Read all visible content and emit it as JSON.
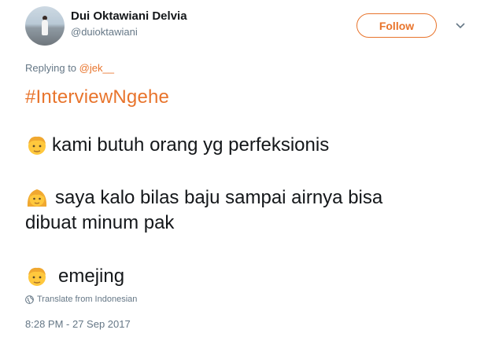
{
  "author": {
    "name": "Dui Oktawiani Delvia",
    "handle": "@duioktawiani"
  },
  "follow_label": "Follow",
  "reply": {
    "prefix": "Replying to ",
    "to": "@jek__"
  },
  "tweet": {
    "hashtag": "#InterviewNgehe",
    "lines": [
      "kami butuh orang yg perfeksionis",
      "saya kalo bilas baju sampai airnya bisa",
      "dibuat minum pak",
      "emejing"
    ]
  },
  "translate_label": "Translate from Indonesian",
  "timestamp": "8:28 PM - 27 Sep 2017",
  "colors": {
    "accent": "#e8742c",
    "muted": "#657786",
    "text": "#14171a",
    "emoji": "#ffc83d"
  },
  "icons": {
    "caret": "chevron-down-icon",
    "globe": "globe-icon",
    "emoji_man": "blond-man-emoji",
    "emoji_woman": "blond-woman-emoji"
  }
}
